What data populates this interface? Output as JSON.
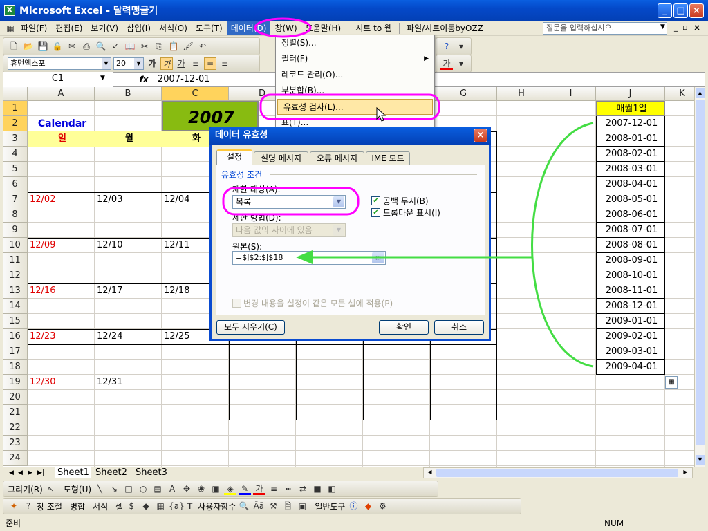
{
  "window": {
    "title": "Microsoft Excel - 달력맹글기",
    "app_icon": "X"
  },
  "menu": {
    "items": [
      "파일(F)",
      "편집(E)",
      "보기(V)",
      "삽입(I)",
      "서식(O)",
      "도구(T)",
      "데이터(D)",
      "창(W)",
      "도움말(H)",
      "시트 to 웹",
      "파일/시트이동byOZZ"
    ],
    "ask_placeholder": "질문을 입력하십시오."
  },
  "format": {
    "font": "휴먼엑스포",
    "size": "20"
  },
  "formula": {
    "cell_ref": "C1",
    "fx": "fx",
    "value": "2007-12-01"
  },
  "columns": [
    "A",
    "B",
    "C",
    "D",
    "E",
    "F",
    "G",
    "H",
    "I",
    "J",
    "K"
  ],
  "rows": [
    "1",
    "2",
    "3",
    "4",
    "5",
    "6",
    "7",
    "8",
    "9",
    "10",
    "11",
    "12",
    "13",
    "14",
    "15",
    "16",
    "17",
    "18",
    "19",
    "20",
    "21",
    "22",
    "23",
    "24"
  ],
  "cells": {
    "a2": "Calendar",
    "a3": "일",
    "b3": "월",
    "c3": "화",
    "c1": "2007",
    "a7": "12/02",
    "b7": "12/03",
    "c7": "12/04",
    "a10": "12/09",
    "b10": "12/10",
    "c10": "12/11",
    "a13": "12/16",
    "b13": "12/17",
    "c13": "12/18",
    "a16": "12/23",
    "b16": "12/24",
    "c16": "12/25",
    "a19": "12/30",
    "b19": "12/31"
  },
  "j_header": "매월1일",
  "j_dates": [
    "2007-12-01",
    "2008-01-01",
    "2008-02-01",
    "2008-03-01",
    "2008-04-01",
    "2008-05-01",
    "2008-06-01",
    "2008-07-01",
    "2008-08-01",
    "2008-09-01",
    "2008-10-01",
    "2008-11-01",
    "2008-12-01",
    "2009-01-01",
    "2009-02-01",
    "2009-03-01",
    "2009-04-01"
  ],
  "data_menu": {
    "items": [
      "정렬(S)...",
      "필터(F)",
      "레코드 관리(O)...",
      "부분합(B)...",
      "유효성 검사(L)...",
      "표(T)..."
    ]
  },
  "dialog": {
    "title": "데이터 유효성",
    "tabs": [
      "설정",
      "설명 메시지",
      "오류 메시지",
      "IME 모드"
    ],
    "section": "유효성 조건",
    "allow_label": "제한 대상(A):",
    "allow_value": "목록",
    "data_label": "제한 방법(D):",
    "data_value": "다음 값의 사이에 있음",
    "ignore_blank": "공백 무시(B)",
    "dropdown": "드롭다운 표시(I)",
    "source_label": "원본(S):",
    "source_value": "=$J$2:$J$18",
    "apply_all": "변경 내용을 설정이 같은 모든 셀에 적용(P)",
    "clear_all": "모두 지우기(C)",
    "ok": "확인",
    "cancel": "취소"
  },
  "sheets": [
    "Sheet1",
    "Sheet2",
    "Sheet3"
  ],
  "drawing_toolbar": {
    "draw": "그리기(R)",
    "shapes": "도형(U)"
  },
  "extra_toolbar": {
    "window_ctrl": "창 조절",
    "merge": "병합",
    "format": "서식",
    "cell": "셀",
    "user_func": "사용자함수",
    "general": "일반도구"
  },
  "status": {
    "ready": "준비",
    "num": "NUM"
  },
  "colors": {
    "highlight": "#ff00ff",
    "arrow": "#44dd44",
    "c1_fill": "#88bb11",
    "header_fill": "#ffff99",
    "j1_fill": "#ffff00",
    "sunday": "#e00000",
    "calendar_blue": "#0000dd"
  }
}
